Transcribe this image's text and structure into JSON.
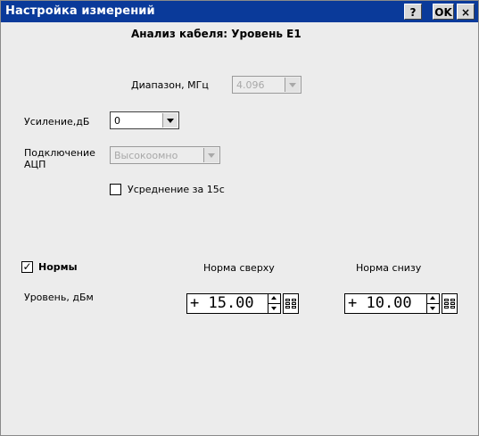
{
  "window": {
    "title": "Настройка измерений",
    "help_label": "?",
    "ok_label": "OK",
    "close_label": "×"
  },
  "header": {
    "subtitle": "Анализ кабеля: Уровень Е1"
  },
  "settings": {
    "range_label": "Диапазон, МГц",
    "range_value": "4.096",
    "gain_label": "Усиление,дБ",
    "gain_value": "0",
    "adc_label_line1": "Подключение",
    "adc_label_line2": "АЦП",
    "adc_value": "Высокоомно",
    "averaging_label": "Усреднение за 15с",
    "averaging_checked": false
  },
  "norms": {
    "enabled_label": "Нормы",
    "enabled_checked": true,
    "check_mark": "✓",
    "upper_header": "Норма сверху",
    "lower_header": "Норма снизу",
    "row_label": "Уровень, дБм",
    "upper_value": "+ 15.00",
    "lower_value": "+ 10.00"
  }
}
